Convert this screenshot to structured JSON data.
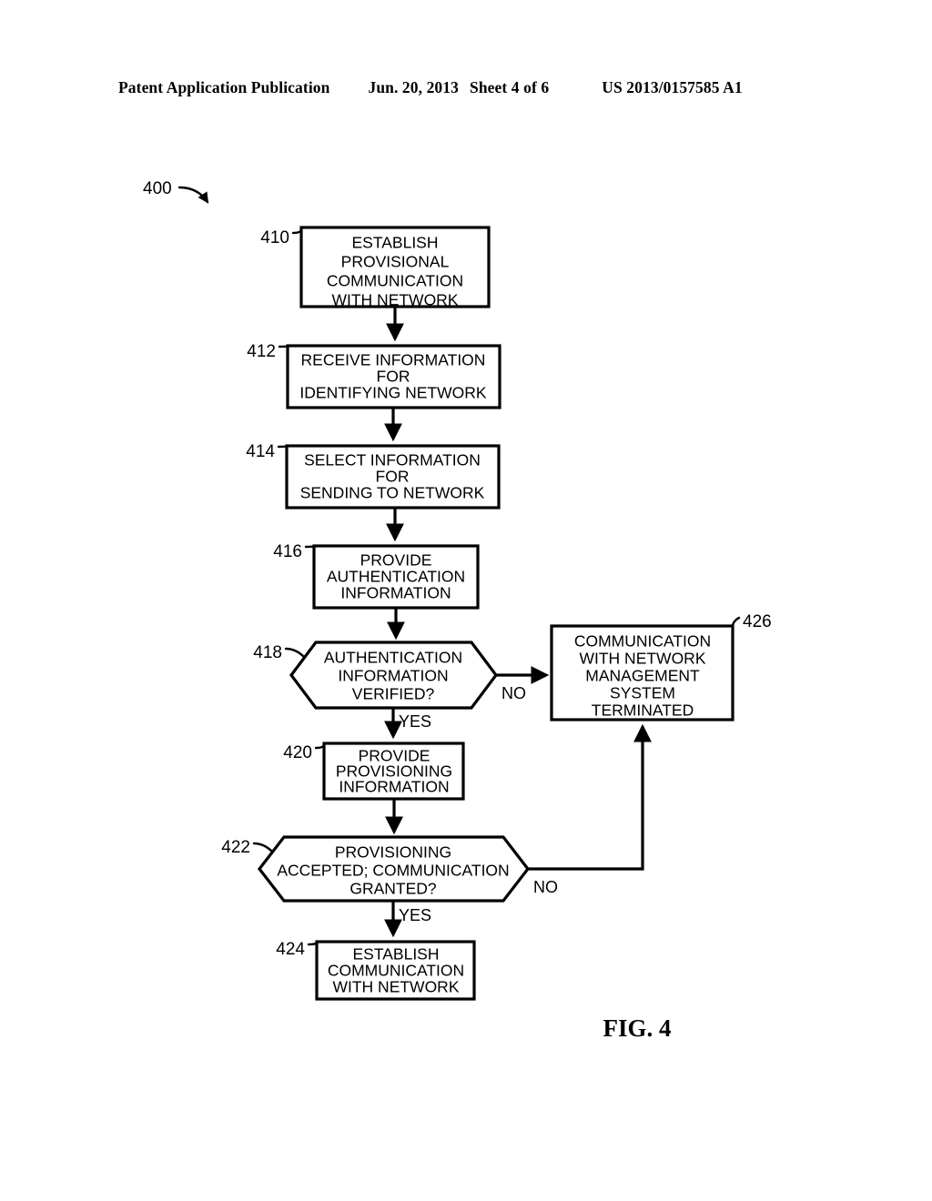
{
  "header": {
    "publication": "Patent Application Publication",
    "date": "Jun. 20, 2013",
    "sheet": "Sheet 4 of 6",
    "patent_number": "US 2013/0157585 A1"
  },
  "figure": {
    "label": "FIG. 4",
    "diagram_ref": "400",
    "type": "flowchart"
  },
  "nodes": {
    "n410": {
      "ref": "410",
      "shape": "process",
      "lines": [
        "ESTABLISH",
        "PROVISIONAL",
        "COMMUNICATION",
        "WITH NETWORK"
      ]
    },
    "n412": {
      "ref": "412",
      "shape": "process",
      "lines": [
        "RECEIVE INFORMATION",
        "FOR",
        "IDENTIFYING NETWORK"
      ]
    },
    "n414": {
      "ref": "414",
      "shape": "process",
      "lines": [
        "SELECT INFORMATION",
        "FOR",
        "SENDING TO NETWORK"
      ]
    },
    "n416": {
      "ref": "416",
      "shape": "process",
      "lines": [
        "PROVIDE",
        "AUTHENTICATION",
        "INFORMATION"
      ]
    },
    "n418": {
      "ref": "418",
      "shape": "decision",
      "lines": [
        "AUTHENTICATION",
        "INFORMATION",
        "VERIFIED?"
      ]
    },
    "n420": {
      "ref": "420",
      "shape": "process",
      "lines": [
        "PROVIDE",
        "PROVISIONING",
        "INFORMATION"
      ]
    },
    "n422": {
      "ref": "422",
      "shape": "decision",
      "lines": [
        "PROVISIONING",
        "ACCEPTED; COMMUNICATION",
        "GRANTED?"
      ]
    },
    "n424": {
      "ref": "424",
      "shape": "process",
      "lines": [
        "ESTABLISH",
        "COMMUNICATION",
        "WITH NETWORK"
      ]
    },
    "n426": {
      "ref": "426",
      "shape": "process",
      "lines": [
        "COMMUNICATION",
        "WITH NETWORK",
        "MANAGEMENT",
        "SYSTEM",
        "TERMINATED"
      ]
    }
  },
  "branch_labels": {
    "b418_no": "NO",
    "b418_yes": "YES",
    "b422_no": "NO",
    "b422_yes": "YES"
  },
  "colors": {
    "ink": "#000000",
    "paper": "#ffffff"
  }
}
